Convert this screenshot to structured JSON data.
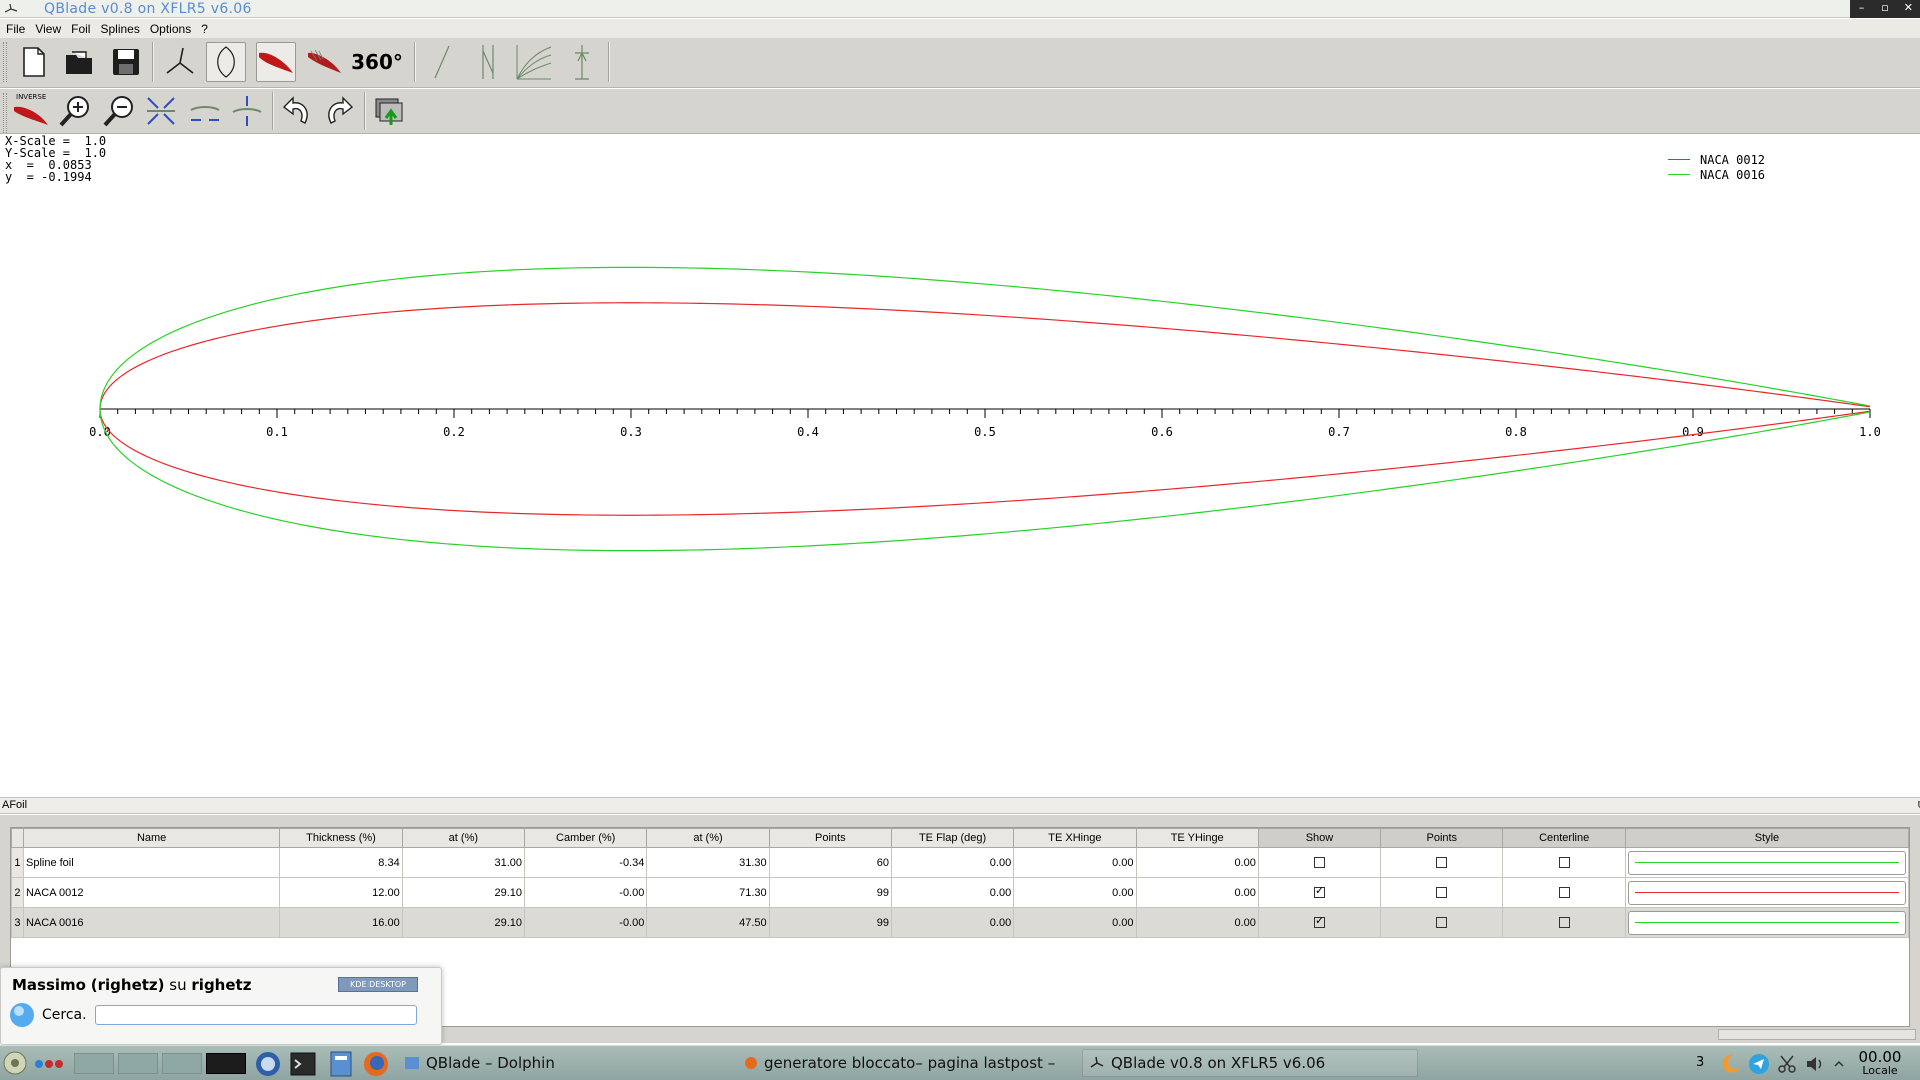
{
  "window": {
    "title": "QBlade v0.8 on XFLR5 v6.06",
    "controls": [
      "–",
      "▫",
      "✕"
    ]
  },
  "menu": {
    "items": [
      "File",
      "View",
      "Foil",
      "Splines",
      "Options",
      "?"
    ]
  },
  "toolbar1": {
    "buttons": [
      "new-document",
      "open-folder",
      "save",
      "hawt-rotor",
      "blade-design",
      "foil-design",
      "direct-design",
      "360-polar",
      "lift-curve",
      "vawt",
      "multi-polar",
      "turbine-sim"
    ],
    "label_360": "360°"
  },
  "toolbar2": {
    "inverse_label": "INVERSE"
  },
  "readout": {
    "x_scale": "X-Scale =  1.0",
    "y_scale": "Y-Scale =  1.0",
    "x": "x  =  0.0853",
    "y": "y  = -0.1994"
  },
  "legend": [
    {
      "name": "NACA 0012",
      "color": "#e8282b"
    },
    {
      "name": "NACA 0016",
      "color": "#27d227"
    }
  ],
  "chart_data": {
    "type": "line",
    "title": "",
    "x_ticks": [
      "0.0",
      "0.1",
      "0.2",
      "0.3",
      "0.4",
      "0.5",
      "0.6",
      "0.7",
      "0.8",
      "0.9",
      "1.0"
    ],
    "xlim": [
      0,
      1
    ],
    "grid": false,
    "legend_position": "top-right",
    "series": [
      {
        "name": "NACA 0012",
        "color": "#e8282b",
        "thickness": 0.12,
        "max_thickness_x": 0.291,
        "camber": 0.0
      },
      {
        "name": "NACA 0016",
        "color": "#27d227",
        "thickness": 0.16,
        "max_thickness_x": 0.291,
        "camber": 0.0
      }
    ]
  },
  "dock": {
    "title": "AFoil",
    "buttons": [
      "⧉",
      "✕"
    ],
    "columns": [
      "Name",
      "Thickness (%)",
      "at (%)",
      "Camber (%)",
      "at (%)",
      "Points",
      "TE Flap (deg)",
      "TE XHinge",
      "TE YHinge",
      "Show",
      "Points",
      "Centerline",
      "Style"
    ],
    "rows": [
      {
        "idx": "1",
        "name": "Spline foil",
        "thickness": "8.34",
        "at1": "31.00",
        "camber": "-0.34",
        "at2": "31.30",
        "points": "60",
        "te_flap": "0.00",
        "te_xhinge": "0.00",
        "te_yhinge": "0.00",
        "show": false,
        "pts": false,
        "centerline": false,
        "style_color": "#27d227"
      },
      {
        "idx": "2",
        "name": "NACA 0012",
        "thickness": "12.00",
        "at1": "29.10",
        "camber": "-0.00",
        "at2": "71.30",
        "points": "99",
        "te_flap": "0.00",
        "te_xhinge": "0.00",
        "te_yhinge": "0.00",
        "show": true,
        "pts": false,
        "centerline": false,
        "style_color": "#e8282b"
      },
      {
        "idx": "3",
        "name": "NACA 0016",
        "thickness": "16.00",
        "at1": "29.10",
        "camber": "-0.00",
        "at2": "47.50",
        "points": "99",
        "te_flap": "0.00",
        "te_xhinge": "0.00",
        "te_yhinge": "0.00",
        "show": true,
        "pts": false,
        "centerline": false,
        "style_color": "#27d227"
      }
    ]
  },
  "kde_popup": {
    "user_name": "Massimo",
    "user_login": "(righetz)",
    "on": "su",
    "host": "righetz",
    "badge": "KDE DESKTOP",
    "search_label": "Cerca.",
    "search_placeholder": ""
  },
  "taskbar": {
    "tasks": [
      "QBlade – Dolphin",
      "generatore bloccato– pagina lastpost –",
      "QBlade v0.8 on XFLR5 v6.06"
    ],
    "tray_count": "3",
    "clock_time": "00.00",
    "clock_label": "Locale"
  }
}
